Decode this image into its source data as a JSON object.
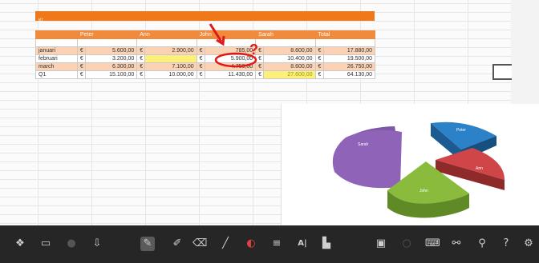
{
  "sheet": {
    "title": "Kt",
    "headers": [
      "",
      "Peter",
      "Ann",
      "John",
      "Sarah",
      "Total"
    ],
    "rows": [
      {
        "label": "januari",
        "c1": "5.600,00",
        "c2": "2.900,00",
        "c3": "785,00",
        "c4": "8.600,00",
        "c5": "17.880,00"
      },
      {
        "label": "februari",
        "c1": "3.200,00",
        "c2": "",
        "c3": "5.900,00",
        "c4": "10.400,00",
        "c5": "19.500,00"
      },
      {
        "label": "march",
        "c1": "6.300,00",
        "c2": "7.100,00",
        "c3": "4.750,00",
        "c4": "8.600,00",
        "c5": "26.750,00"
      },
      {
        "label": "Q1",
        "c1": "15.100,00",
        "c2": "10.000,00",
        "c3": "11.430,00",
        "c4": "27.600,00",
        "c5": "64.130,00"
      }
    ],
    "currency": "€"
  },
  "annotation": {
    "mark": "?"
  },
  "chart": {
    "slices": [
      {
        "label": "Sarah",
        "color": "#7e57a8"
      },
      {
        "label": "Peter",
        "color": "#1f6fb5"
      },
      {
        "label": "Ann",
        "color": "#c0393b"
      },
      {
        "label": "John",
        "color": "#79a832"
      }
    ]
  },
  "taskbar": {
    "icons": [
      "windows-icon",
      "screen-icon",
      "dot-icon",
      "download-icon",
      "cursor-icon",
      "pen-icon",
      "eraser-icon",
      "marker-icon",
      "ring-icon",
      "lines-icon",
      "text-icon",
      "chart-icon",
      "photo-icon",
      "record-icon",
      "keyboard-icon",
      "share-icon",
      "zoom-icon",
      "help-icon",
      "settings-icon"
    ],
    "glyphs": {
      "text": "A|"
    }
  }
}
